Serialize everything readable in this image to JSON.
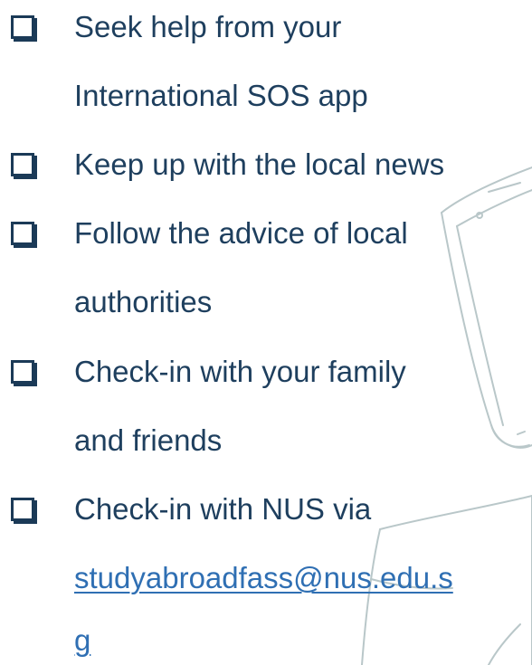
{
  "checklist": {
    "items": [
      {
        "line1": "Seek help from your",
        "line2": "International SOS app"
      },
      {
        "line1": "Keep up with the local news"
      },
      {
        "line1": "Follow the advice of local",
        "line2": "authorities"
      },
      {
        "line1": "Check-in with your family",
        "line2": "and friends"
      },
      {
        "line1": "Check-in with NUS via",
        "link_line1": "studyabroadfass@nus.edu.s",
        "link_line2": "g"
      }
    ]
  },
  "colors": {
    "text": "#1e3f5e",
    "link": "#2f6fb3",
    "checkbox": "#1b3a57",
    "sketch": "#b9c7c9"
  },
  "icons": [
    "checkbox-icon",
    "phone-sketch-icon",
    "paper-sketch-icon"
  ]
}
